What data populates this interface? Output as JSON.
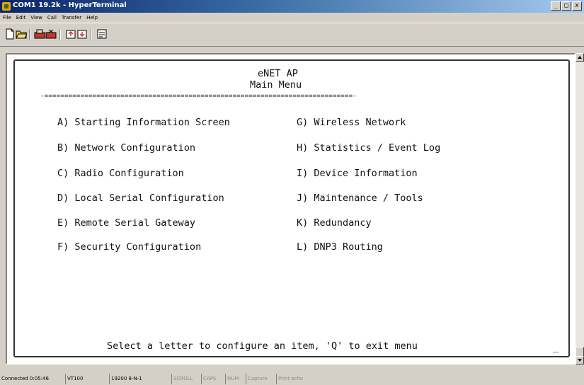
{
  "window": {
    "title": "COM1 19.2k - HyperTerminal",
    "controls": [
      "_",
      "□",
      "x"
    ]
  },
  "menubar": [
    "File",
    "Edit",
    "View",
    "Call",
    "Transfer",
    "Help"
  ],
  "toolbar": {
    "buttons": [
      "new-icon",
      "open-icon",
      "connect-icon",
      "disconnect-icon",
      "send-icon",
      "receive-icon",
      "properties-icon"
    ]
  },
  "terminal": {
    "header_title": "eNET AP",
    "header_subtitle": "Main Menu",
    "divider": "-=============================================================================-",
    "left_options": [
      "A) Starting Information Screen",
      "B) Network Configuration",
      "C) Radio Configuration",
      "D) Local Serial Configuration",
      "E) Remote Serial Gateway",
      "F) Security Configuration"
    ],
    "right_options": [
      "G) Wireless Network",
      "H) Statistics / Event Log",
      "I) Device Information",
      "J) Maintenance / Tools",
      "K) Redundancy",
      "L) DNP3 Routing"
    ],
    "prompt": "Select a letter to configure an item, 'Q' to exit menu",
    "cursor": "_"
  },
  "statusbar": {
    "connected": "Connected 0:05:46",
    "emulation": "VT100",
    "port_settings": "19200 8-N-1",
    "scroll": "SCROLL",
    "caps": "CAPS",
    "num": "NUM",
    "capture": "Capture",
    "print_echo": "Print echo"
  }
}
